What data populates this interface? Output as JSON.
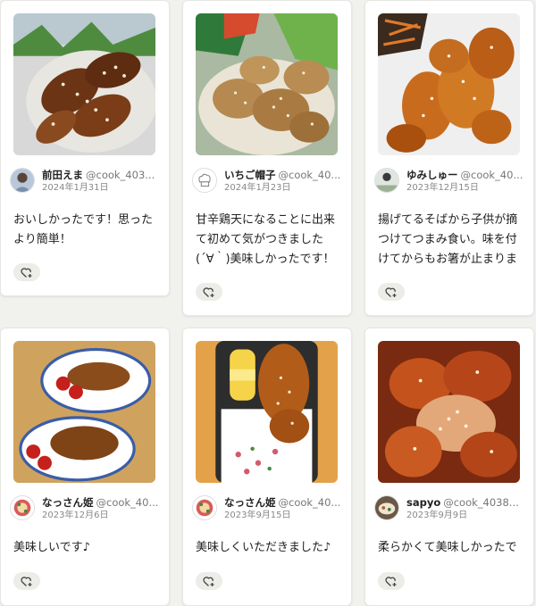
{
  "cards": [
    {
      "user": "前田えま",
      "handle": "@cook_403...",
      "date": "2024年1月31日",
      "comment": "おいしかったです！思ったより簡単！"
    },
    {
      "user": "いちご帽子",
      "handle": "@cook_40...",
      "date": "2024年1月23日",
      "comment": "甘辛鶏天になることに出来て初めて気がつきました(´∀｀)美味しかったです！"
    },
    {
      "user": "ゆみしゅー",
      "handle": "@cook_40...",
      "date": "2023年12月15日",
      "comment": "揚げてるそばから子供が摘つけてつまみ食い。味を付けてからもお箸が止まりませんでし..."
    },
    {
      "user": "なっさん姫",
      "handle": "@cook_40...",
      "date": "2023年12月6日",
      "comment": "美味しいです♪"
    },
    {
      "user": "なっさん姫",
      "handle": "@cook_40...",
      "date": "2023年9月15日",
      "comment": "美味しくいただきました♪"
    },
    {
      "user": "sapyo",
      "handle": "@cook_4038...",
      "date": "2023年9月9日",
      "comment": "柔らかくて美味しかったです！"
    }
  ]
}
